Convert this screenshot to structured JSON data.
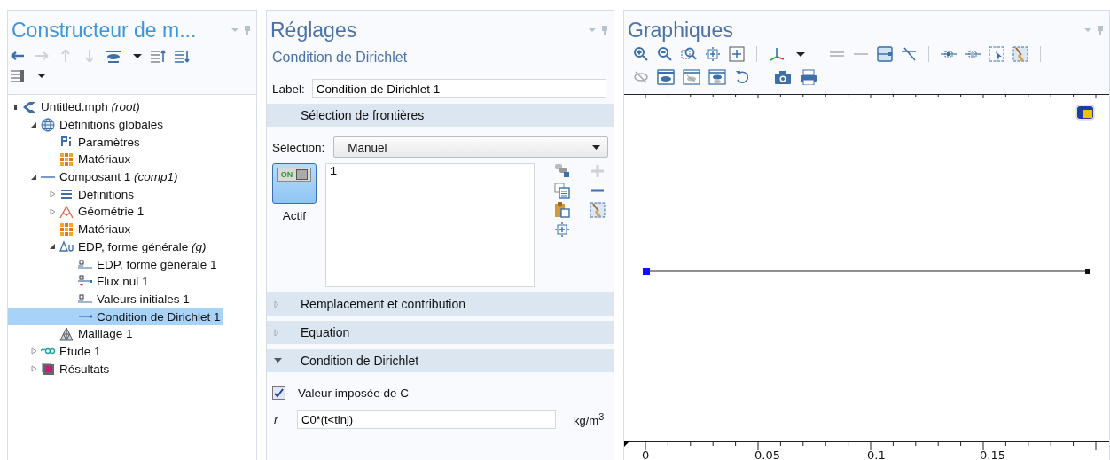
{
  "builder": {
    "title": "Constructeur de m...",
    "toolbar": [
      {
        "kind": "back",
        "disabled": false
      },
      {
        "kind": "forward",
        "disabled": true
      },
      {
        "kind": "up",
        "disabled": true
      },
      {
        "kind": "down",
        "disabled": true
      },
      {
        "kind": "eye",
        "disabled": false
      },
      {
        "kind": "caret",
        "disabled": false
      },
      {
        "kind": "collapse",
        "disabled": false
      },
      {
        "kind": "expand",
        "disabled": false
      },
      {
        "kind": "break"
      },
      {
        "kind": "listview",
        "disabled": false
      },
      {
        "kind": "caret",
        "disabled": false
      }
    ],
    "tree": [
      {
        "kind": "root",
        "label": "Untitled.mph *(root)*",
        "selected": false,
        "children": [
          {
            "kind": "globe",
            "label": "Définitions globales",
            "expanded": true,
            "selected": false,
            "children": [
              {
                "kind": "param",
                "label": "Paramètres",
                "selected": false
              },
              {
                "kind": "material",
                "label": "Matériaux",
                "selected": false
              }
            ]
          },
          {
            "kind": "component",
            "label": "Composant 1 *(comp1)*",
            "expanded": true,
            "selected": false,
            "children": [
              {
                "kind": "definitions",
                "label": "Définitions",
                "expanded": false,
                "selected": false
              },
              {
                "kind": "geometry",
                "label": "Géométrie 1",
                "expanded": false,
                "selected": false
              },
              {
                "kind": "material",
                "label": "Matériaux",
                "selected": false
              },
              {
                "kind": "pde",
                "label": "EDP, forme générale *(g)*",
                "expanded": true,
                "selected": false,
                "children": [
                  {
                    "kind": "domain",
                    "label": "EDP, forme générale 1",
                    "selected": false
                  },
                  {
                    "kind": "flux",
                    "label": "Flux nul 1",
                    "selected": false
                  },
                  {
                    "kind": "domain",
                    "label": "Valeurs initiales 1",
                    "selected": false
                  },
                  {
                    "kind": "boundary",
                    "label": "Condition de Dirichlet 1",
                    "selected": true
                  }
                ]
              },
              {
                "kind": "mesh",
                "label": "Maillage 1",
                "selected": false
              }
            ]
          },
          {
            "kind": "study",
            "label": "Etude 1",
            "expanded": false,
            "selected": false
          },
          {
            "kind": "results",
            "label": "Résultats",
            "expanded": false,
            "selected": false
          }
        ]
      }
    ]
  },
  "settings": {
    "title": "Réglages",
    "subtitle": "Condition de Dirichlet",
    "label_caption": "Label:",
    "label_value": "Condition de Dirichlet 1",
    "sections": [
      {
        "kind": "selection",
        "title": "Sélection de frontières",
        "selection_caption": "Sélection:",
        "selection_value": "Manuel",
        "toggle_text": "ON",
        "toggle_on": true,
        "toggle_caption": "Actif",
        "list": [
          "1"
        ],
        "tools": [
          {
            "kind": "link",
            "disabled": false
          },
          {
            "kind": "plus",
            "disabled": true
          },
          {
            "kind": "copy",
            "disabled": false
          },
          {
            "kind": "minus",
            "disabled": false
          },
          {
            "kind": "paste",
            "disabled": false
          },
          {
            "kind": "clear",
            "disabled": false
          },
          {
            "kind": "zoomsel",
            "disabled": false
          }
        ]
      },
      {
        "title": "Remplacement et contribution",
        "expanded": false
      },
      {
        "title": "Equation",
        "expanded": false
      },
      {
        "kind": "dirichlet",
        "title": "Condition de Dirichlet",
        "expanded": true,
        "checkbox_label": "Valeur imposée de C",
        "checked": true,
        "symbol": "r",
        "value": "C0*(t<tinj)",
        "unit": "kg/m$^{3}$"
      }
    ]
  },
  "graphics": {
    "title": "Graphiques",
    "toolbar_rows": [
      [
        {
          "kind": "zoomin",
          "on": false
        },
        {
          "kind": "zoomout",
          "on": false
        },
        {
          "kind": "zoombox",
          "on": false
        },
        {
          "kind": "zoomselected",
          "on": false
        },
        {
          "kind": "zoomextents",
          "on": false
        },
        {
          "kind": "separator"
        },
        {
          "kind": "axes",
          "on": false
        },
        {
          "kind": "caret",
          "on": false
        },
        {
          "kind": "separator"
        },
        {
          "kind": "doubleline",
          "on": false
        },
        {
          "kind": "singleline",
          "on": false
        },
        {
          "kind": "panel",
          "on": true
        },
        {
          "kind": "diagonal",
          "on": false
        },
        {
          "kind": "separator"
        },
        {
          "kind": "pointsel",
          "on": false
        },
        {
          "kind": "pointgrey",
          "on": false
        },
        {
          "kind": "boxsel",
          "on": false
        },
        {
          "kind": "clear",
          "on": false
        },
        {
          "kind": "separator"
        }
      ],
      [
        {
          "kind": "hide",
          "on": false
        },
        {
          "kind": "eyewin",
          "on": true
        },
        {
          "kind": "eyewincross",
          "on": false
        },
        {
          "kind": "eyewinhalf",
          "on": false
        },
        {
          "kind": "reset",
          "on": false
        },
        {
          "kind": "separator"
        },
        {
          "kind": "camera",
          "on": false
        },
        {
          "kind": "print",
          "on": false
        }
      ]
    ],
    "axis_ticks": [
      "0",
      "0.05",
      "0.1",
      "0.15"
    ]
  }
}
